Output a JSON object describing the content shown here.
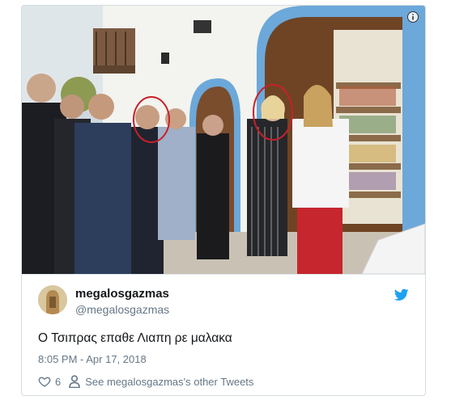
{
  "tweet": {
    "display_name": "megalosgazmas",
    "handle": "@megalosgazmas",
    "text": "Ο Τσιπρας επαθε Λιαπη ρε μαλακα",
    "timestamp": "8:05 PM - Apr 17, 2018",
    "like_count": "6",
    "other_tweets_link": "See megalosgazmas's other Tweets"
  },
  "icons": {
    "info": "info-icon",
    "twitter": "twitter-bird-icon",
    "like": "heart-icon",
    "profile": "person-icon"
  },
  "colors": {
    "twitter_blue": "#1da1f2",
    "secondary_text": "#657786",
    "circle_annotation": "#c8202a"
  }
}
